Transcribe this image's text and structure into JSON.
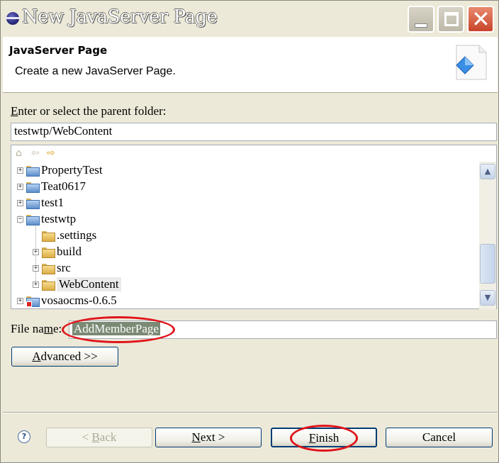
{
  "window": {
    "title": "New JavaServer Page"
  },
  "banner": {
    "title": "JavaServer Page",
    "description": "Create a new JavaServer Page."
  },
  "parent_folder": {
    "label_accel": "E",
    "label_rest": "nter or select the parent folder:",
    "value": "testwtp/WebContent"
  },
  "tree": {
    "items": [
      {
        "label": "PropertyTest",
        "expanded": false,
        "icon": "project-folder-icon"
      },
      {
        "label": "Teat0617",
        "expanded": false,
        "icon": "project-folder-icon"
      },
      {
        "label": "test1",
        "expanded": false,
        "icon": "project-folder-icon"
      },
      {
        "label": "testwtp",
        "expanded": true,
        "icon": "project-folder-icon"
      },
      {
        "label": ".settings",
        "expanded": false,
        "icon": "folder-icon"
      },
      {
        "label": "build",
        "expanded": false,
        "icon": "folder-icon"
      },
      {
        "label": "src",
        "expanded": false,
        "icon": "folder-icon"
      },
      {
        "label": "WebContent",
        "expanded": false,
        "icon": "folder-icon",
        "selected": true
      },
      {
        "label": "vosaocms-0.6.5",
        "expanded": false,
        "icon": "project-error-icon"
      }
    ]
  },
  "file_name": {
    "label_pre": "File na",
    "label_accel": "m",
    "label_post": "e:",
    "value": "AddMemberPage"
  },
  "buttons": {
    "advanced_accel": "A",
    "advanced_rest": "dvanced >>",
    "back_pre": "< ",
    "back_accel": "B",
    "back_rest": "ack",
    "next_accel": "N",
    "next_rest": "ext >",
    "finish_accel": "F",
    "finish_rest": "inish",
    "cancel": "Cancel"
  },
  "colors": {
    "highlight_ring": "#e0141a",
    "selection": "#7a8a74"
  }
}
